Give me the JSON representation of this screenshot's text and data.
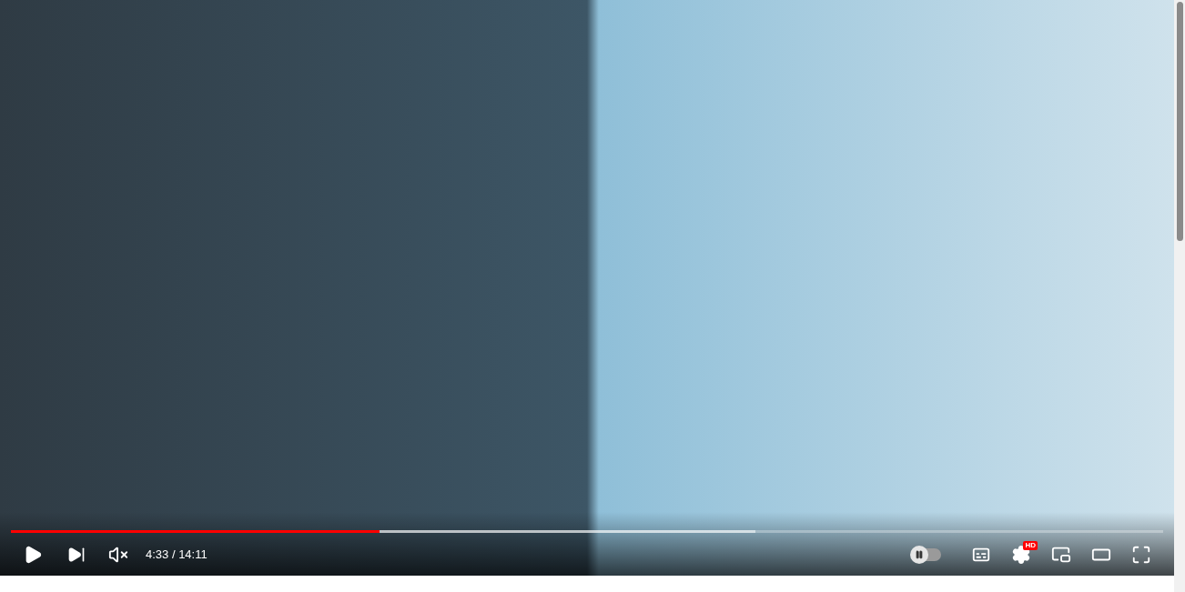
{
  "player": {
    "playing": false,
    "muted": true,
    "time": "4:33 / 14:11",
    "progress": {
      "level": 0.32
    },
    "buffered": {
      "level": 0.646
    },
    "autoplay": {
      "on": false
    },
    "quality_badge": "HD"
  }
}
